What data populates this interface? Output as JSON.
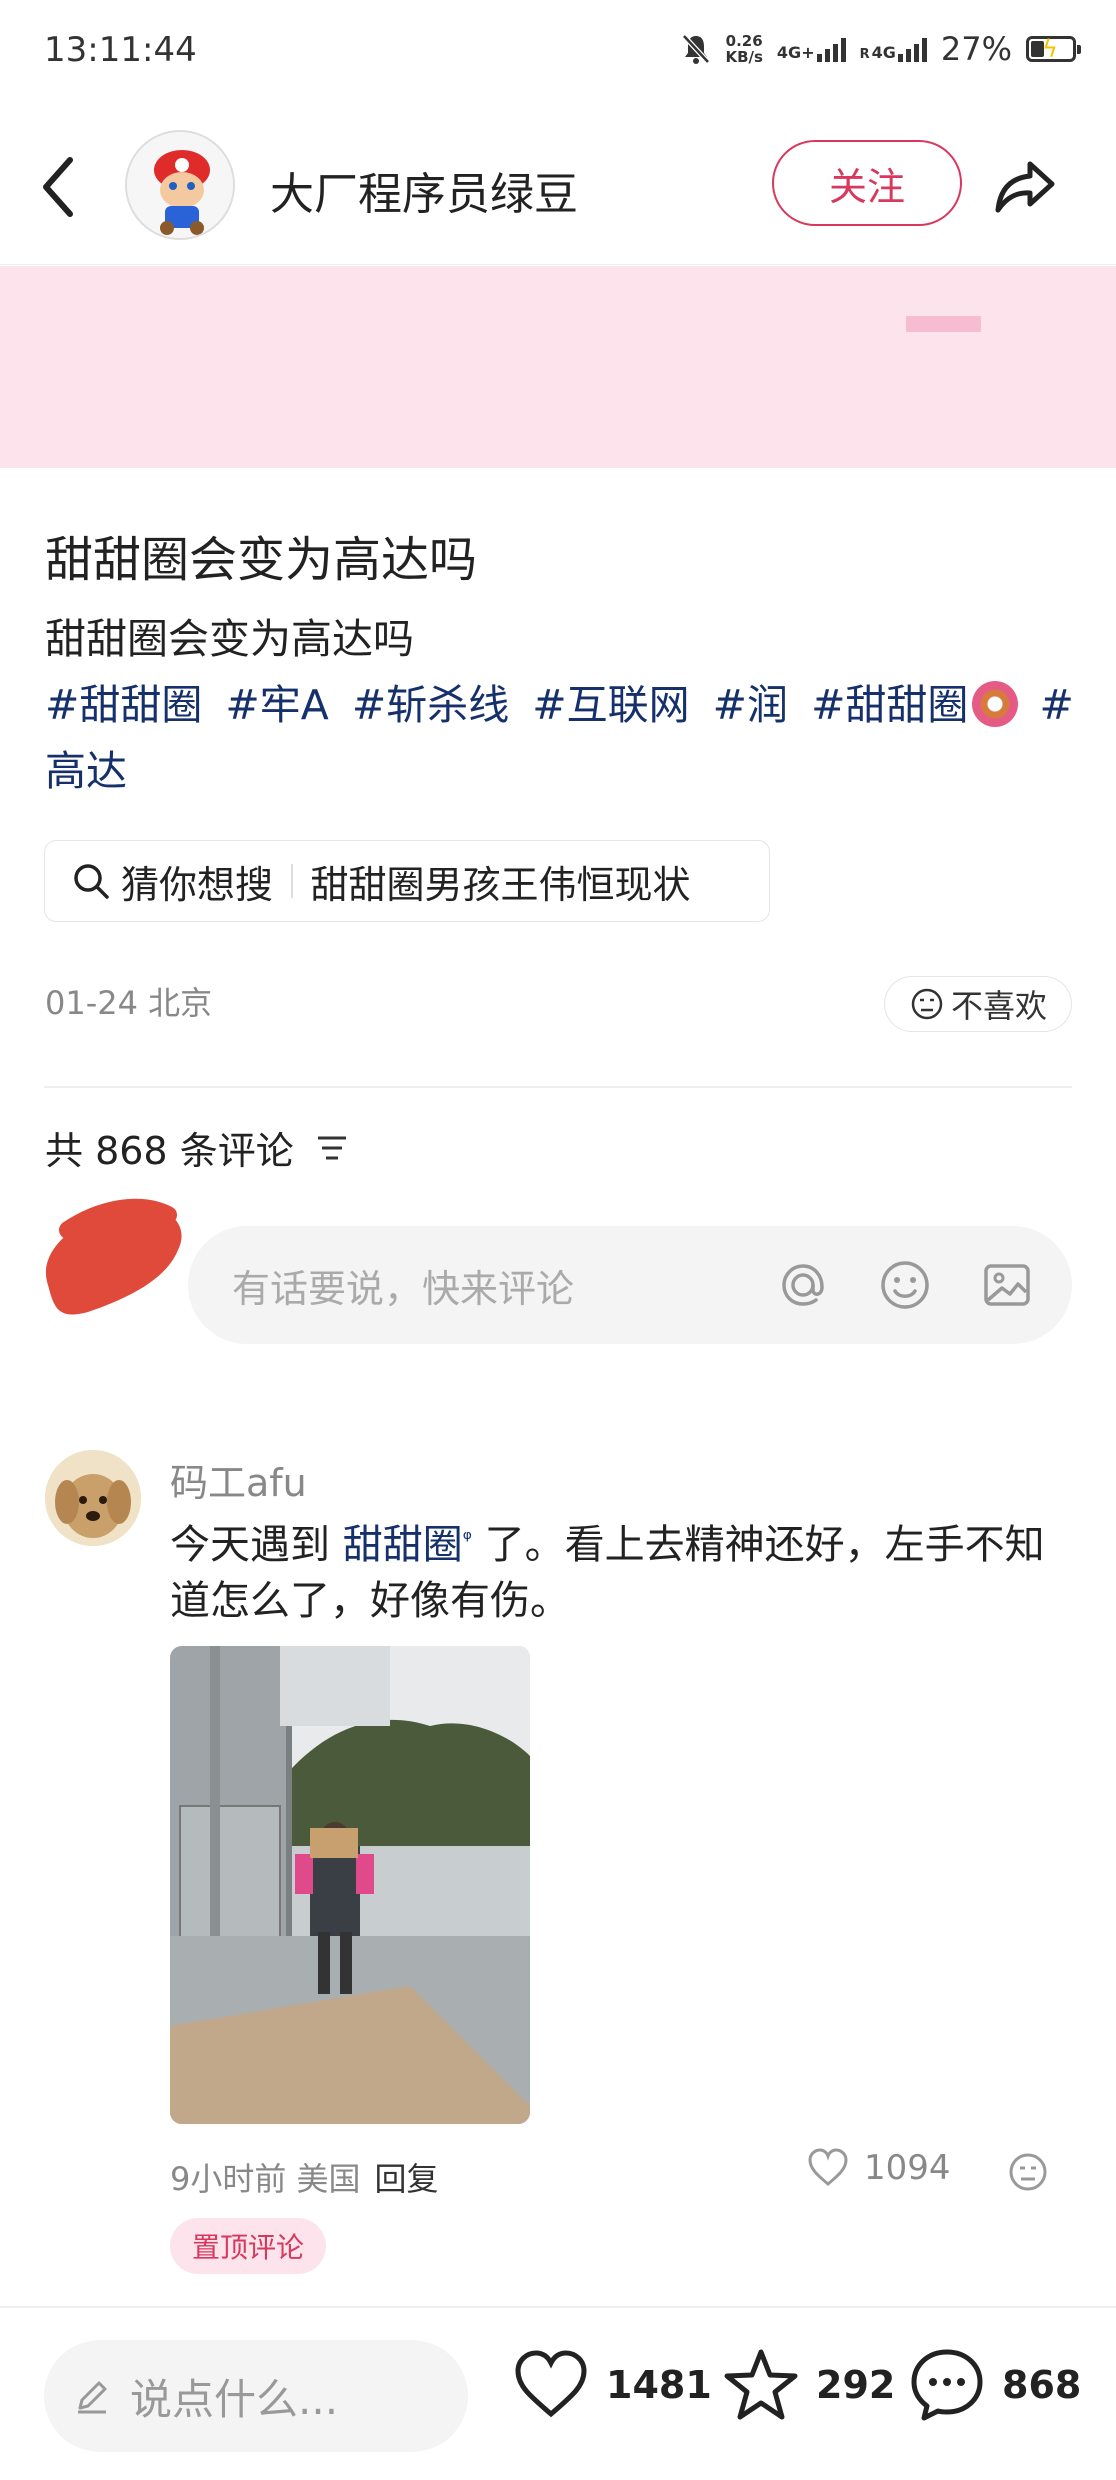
{
  "status_bar": {
    "time": "13:11:44",
    "net_speed_value": "0.26",
    "net_speed_unit": "KB/s",
    "sim1": "4G+",
    "sim2_prefix": "R",
    "sim2": "4G",
    "battery_percent": "27%"
  },
  "header": {
    "author_name": "大厂程序员绿豆",
    "follow_label": "关注"
  },
  "post": {
    "title": "甜甜圈会变为高达吗",
    "body": "甜甜圈会变为高达吗",
    "tags": [
      "#甜甜圈",
      "#牢A",
      "#斩杀线",
      "#互联网",
      "#润",
      "#甜甜圈",
      "#高达"
    ],
    "guess_label": "猜你想搜",
    "guess_query": "甜甜圈男孩王伟恒现状",
    "date_location": "01-24 北京",
    "dislike_label": "不喜欢"
  },
  "comments_section": {
    "count_label": "共 868 条评论",
    "input_placeholder": "有话要说，快来评论"
  },
  "comment": {
    "author": "码工afu",
    "text_before": "今天遇到 ",
    "link_text": "甜甜圈",
    "text_after": " 了。看上去精神还好，左手不知道怎么了，好像有伤。",
    "meta": "9小时前 美国",
    "reply_label": "回复",
    "likes": "1094",
    "pinned_label": "置顶评论"
  },
  "bottom_bar": {
    "say_placeholder": "说点什么...",
    "likes": "1481",
    "favorites": "292",
    "comments": "868"
  },
  "colors": {
    "accent": "#d8385d",
    "tag_blue": "#15306b",
    "banner_bg": "#fde3ec"
  },
  "icons": [
    "back-icon",
    "share-icon",
    "search-icon",
    "dislike-face-icon",
    "filter-icon",
    "at-icon",
    "emoji-icon",
    "image-icon",
    "heart-icon",
    "star-icon",
    "comment-icon",
    "pencil-icon"
  ]
}
